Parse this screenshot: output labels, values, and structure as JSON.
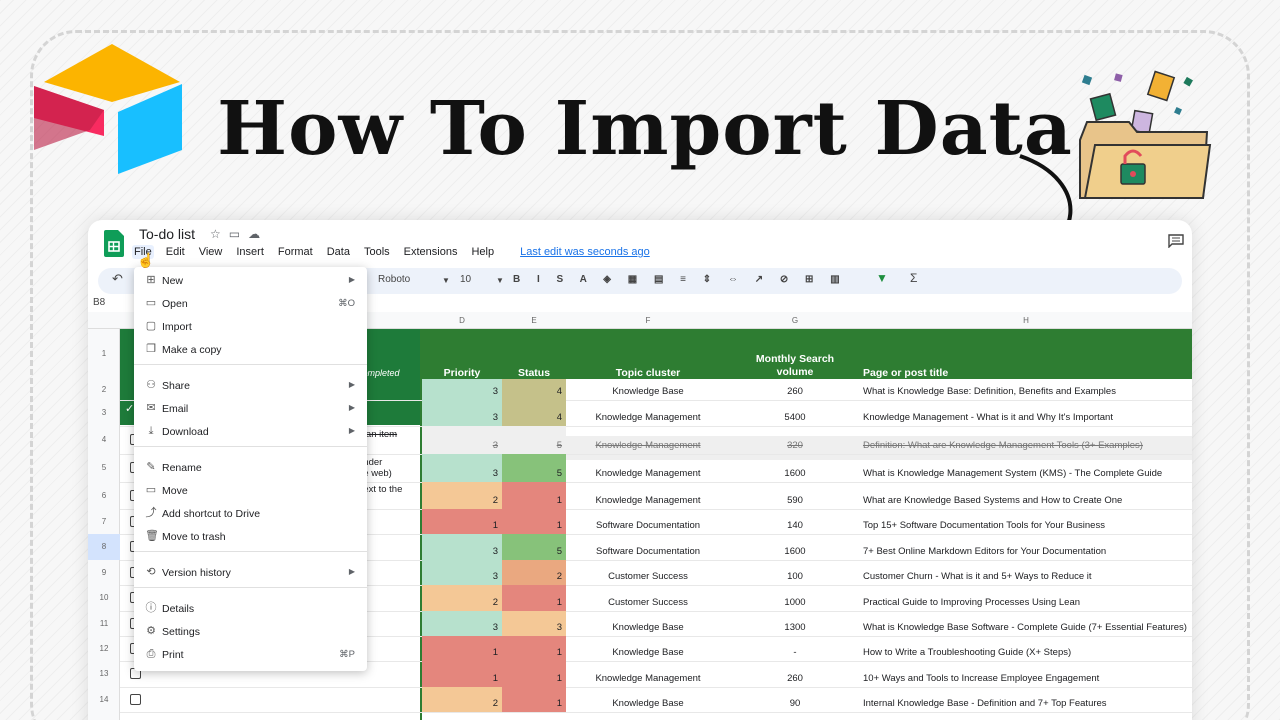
{
  "headline": "How To Import Data",
  "sheet": {
    "title": "To-do list",
    "menu": [
      "File",
      "Edit",
      "View",
      "Insert",
      "Format",
      "Data",
      "Tools",
      "Extensions",
      "Help"
    ],
    "last_edit": "Last edit was seconds ago",
    "font": "Roboto",
    "font_size": "10",
    "cell_ref": "B8",
    "col_letters": [
      "D",
      "E",
      "F",
      "G",
      "H"
    ],
    "headers": {
      "priority": "Priority",
      "status": "Status",
      "topic": "Topic cluster",
      "volume": "Monthly Search volume",
      "title": "Page or post title",
      "completed": "completed"
    },
    "row_numbers": [
      "1",
      "2",
      "3",
      "4",
      "5",
      "6",
      "7",
      "8",
      "9",
      "10",
      "11",
      "12",
      "13",
      "14"
    ],
    "left_fragments": [
      "e an item",
      "under",
      "he web)",
      "next to the"
    ],
    "rows": [
      {
        "priority": "3",
        "status": "4",
        "topic": "Knowledge Base",
        "volume": "260",
        "title": "What is Knowledge Base: Definition, Benefits and Examples",
        "p_color": "#b7e1cd",
        "s_color": "#c5c18a"
      },
      {
        "priority": "3",
        "status": "4",
        "topic": "Knowledge Management",
        "volume": "5400",
        "title": "Knowledge Management - What is it and Why It's Important",
        "p_color": "#b7e1cd",
        "s_color": "#c5c18a"
      },
      {
        "priority": "3",
        "status": "5",
        "topic": "Knowledge Management",
        "volume": "320",
        "title": "Definition: What are Knowledge Management Tools (3+ Examples)",
        "p_color": "#efefef",
        "s_color": "#efefef",
        "struck": true
      },
      {
        "priority": "3",
        "status": "5",
        "topic": "Knowledge Management",
        "volume": "1600",
        "title": "What is Knowledge Management System (KMS) - The Complete Guide",
        "p_color": "#b7e1cd",
        "s_color": "#87c27a"
      },
      {
        "priority": "2",
        "status": "1",
        "topic": "Knowledge Management",
        "volume": "590",
        "title": "What are Knowledge Based Systems and How to Create One",
        "p_color": "#f4c896",
        "s_color": "#e4867d"
      },
      {
        "priority": "1",
        "status": "1",
        "topic": "Software Documentation",
        "volume": "140",
        "title": "Top 15+ Software Documentation Tools for Your Business",
        "p_color": "#e4867d",
        "s_color": "#e4867d"
      },
      {
        "priority": "3",
        "status": "5",
        "topic": "Software Documentation",
        "volume": "1600",
        "title": "7+ Best Online Markdown Editors for Your Documentation",
        "p_color": "#b7e1cd",
        "s_color": "#87c27a"
      },
      {
        "priority": "3",
        "status": "2",
        "topic": "Customer Success",
        "volume": "100",
        "title": "Customer Churn - What is it and 5+ Ways to Reduce it",
        "p_color": "#b7e1cd",
        "s_color": "#eaa880"
      },
      {
        "priority": "2",
        "status": "1",
        "topic": "Customer Success",
        "volume": "1000",
        "title": "Practical Guide to Improving Processes Using Lean",
        "p_color": "#f4c896",
        "s_color": "#e4867d"
      },
      {
        "priority": "3",
        "status": "3",
        "topic": "Knowledge Base",
        "volume": "1300",
        "title": "What is Knowledge Base Software - Complete Guide (7+ Essential Features)",
        "p_color": "#b7e1cd",
        "s_color": "#f4c896"
      },
      {
        "priority": "1",
        "status": "1",
        "topic": "Knowledge Base",
        "volume": "-",
        "title": "How to Write a Troubleshooting Guide (X+ Steps)",
        "p_color": "#e4867d",
        "s_color": "#e4867d"
      },
      {
        "priority": "1",
        "status": "1",
        "topic": "Knowledge Management",
        "volume": "260",
        "title": "10+ Ways and Tools to Increase Employee Engagement",
        "p_color": "#e4867d",
        "s_color": "#e4867d"
      },
      {
        "priority": "2",
        "status": "1",
        "topic": "Knowledge Base",
        "volume": "90",
        "title": "Internal Knowledge Base - Definition and 7+ Top Features",
        "p_color": "#f4c896",
        "s_color": "#e4867d"
      }
    ]
  },
  "file_menu": [
    {
      "icon": "new-icon",
      "label": "New",
      "shortcut": "",
      "arrow": true
    },
    {
      "icon": "folder-icon",
      "label": "Open",
      "shortcut": "⌘O",
      "arrow": false
    },
    {
      "icon": "import-icon",
      "label": "Import",
      "shortcut": "",
      "arrow": false
    },
    {
      "icon": "copy-icon",
      "label": "Make a copy",
      "shortcut": "",
      "arrow": false
    },
    {
      "icon": "share-icon",
      "label": "Share",
      "shortcut": "",
      "arrow": true
    },
    {
      "icon": "email-icon",
      "label": "Email",
      "shortcut": "",
      "arrow": true
    },
    {
      "icon": "download-icon",
      "label": "Download",
      "shortcut": "",
      "arrow": true
    },
    {
      "icon": "rename-icon",
      "label": "Rename",
      "shortcut": "",
      "arrow": false
    },
    {
      "icon": "move-icon",
      "label": "Move",
      "shortcut": "",
      "arrow": false
    },
    {
      "icon": "shortcut-icon",
      "label": "Add shortcut to Drive",
      "shortcut": "",
      "arrow": false
    },
    {
      "icon": "trash-icon",
      "label": "Move to trash",
      "shortcut": "",
      "arrow": false
    },
    {
      "icon": "history-icon",
      "label": "Version history",
      "shortcut": "",
      "arrow": true
    },
    {
      "icon": "info-icon",
      "label": "Details",
      "shortcut": "",
      "arrow": false
    },
    {
      "icon": "settings-icon",
      "label": "Settings",
      "shortcut": "",
      "arrow": false
    },
    {
      "icon": "print-icon",
      "label": "Print",
      "shortcut": "⌘P",
      "arrow": false
    }
  ],
  "colors": {
    "header_green": "#2e7d32",
    "dark_green": "#1e7b3a",
    "accent_blue": "#1a73e8"
  }
}
